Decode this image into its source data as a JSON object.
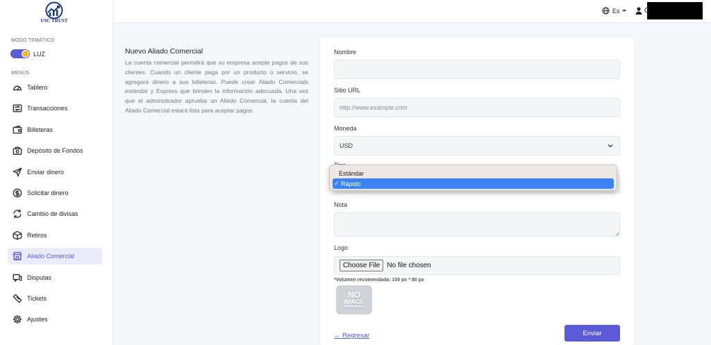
{
  "brand": {
    "logo_text": "USC TRUST"
  },
  "sidebar": {
    "theme_section": "MODO TEMÁTICO",
    "theme_label": "LUZ",
    "menu_section": "MENÚS",
    "items": [
      {
        "label": "Tablero",
        "icon": "gauge-icon"
      },
      {
        "label": "Transacciones",
        "icon": "transactions-icon"
      },
      {
        "label": "Billeteras",
        "icon": "wallet-icon"
      },
      {
        "label": "Depósito de Fondos",
        "icon": "deposit-icon"
      },
      {
        "label": "Enviar dinero",
        "icon": "send-icon"
      },
      {
        "label": "Solicitar dinero",
        "icon": "request-money-icon"
      },
      {
        "label": "Cambio de divisas",
        "icon": "exchange-icon"
      },
      {
        "label": "Retiros",
        "icon": "withdraw-icon"
      },
      {
        "label": "Aliado Comercial",
        "icon": "store-icon"
      },
      {
        "label": "Disputas",
        "icon": "disputes-icon"
      },
      {
        "label": "Tickets",
        "icon": "ticket-icon"
      },
      {
        "label": "Ajustes",
        "icon": "gear-icon"
      }
    ],
    "active_index": 8,
    "accent_color": "#5b5bd6"
  },
  "header": {
    "language": "Es",
    "user_initial": "C"
  },
  "intro": {
    "title": "Nuevo Aliado Comercial",
    "text": "La cuenta comercial permitirá que su empresa acepte pagos de sus clientes. Cuando un cliente paga por un producto o servicio, se agregará dinero a sus billeteras. Puede crear Aliado Comercials estándar y Express que brinden la información adecuada. Una vez que el administrador aprueba un Aliado Comercial, la cuenta del Aliado Comercial estará lista para aceptar pagos."
  },
  "form": {
    "name_label": "Nombre",
    "name_value": "",
    "url_label": "Sitio URL",
    "url_placeholder": "http://www.example.com",
    "currency_label": "Moneda",
    "currency_value": "USD",
    "type_label": "Tipo",
    "type_options": [
      "Estándar",
      "Rápido"
    ],
    "type_selected": "Rápido",
    "note_label": "Nota",
    "logo_label": "Logo",
    "file_button": "Choose File",
    "file_status": "No file chosen",
    "hint": "*Volumen recomendada: 100 px * 80 px",
    "placeholder_image": {
      "line1": "NO",
      "line2": "IMAGE",
      "line3": "AVAILABLE"
    },
    "back_label": "Regresar",
    "back_arrow": "←",
    "submit_label": "Enviar"
  }
}
